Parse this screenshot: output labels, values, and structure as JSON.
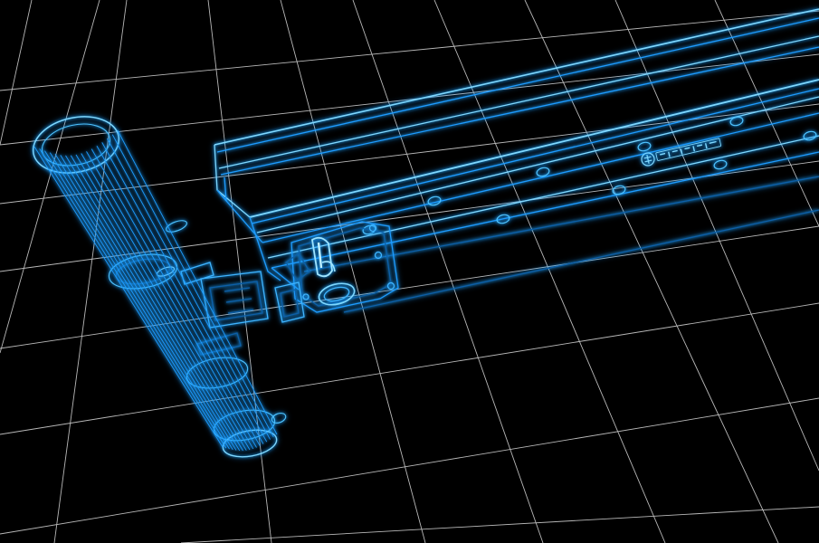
{
  "colors": {
    "background": "#000000",
    "grid": "#d9d9d9",
    "wire_bright": "#7fd8ff",
    "wire": "#1e9bff",
    "wire_dim": "#0d5fa8"
  },
  "viewport": {
    "label_plate_icon": "logo-badge-icon"
  }
}
